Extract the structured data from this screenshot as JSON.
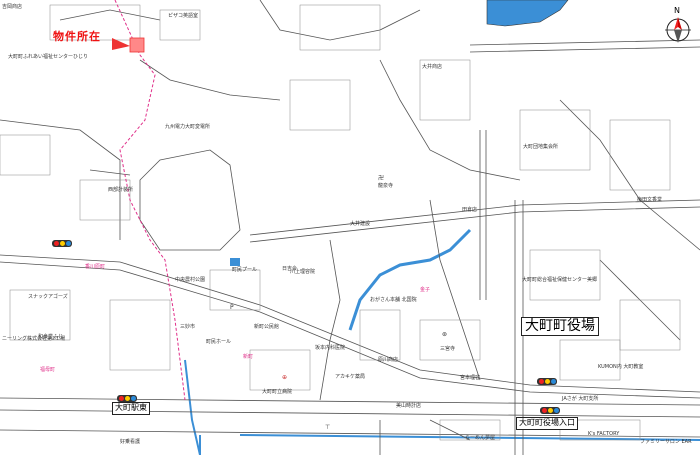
{
  "map": {
    "property_label": "物件所在",
    "town_hall_label": "大町町役場",
    "station_label": "大町駅東",
    "town_hall_entrance_label": "大町町役場入口",
    "compass_label": "N",
    "colors": {
      "river": "#3b8fd6",
      "boundary": "#e0308a",
      "property": "#e33"
    },
    "places": [
      {
        "name": "大町町ふれあい福祉センターひじり"
      },
      {
        "name": "ピザコ英語室"
      },
      {
        "name": "九州電力大町変電所"
      },
      {
        "name": "西部計装所"
      },
      {
        "name": "龍泉寺"
      },
      {
        "name": "大井商店"
      },
      {
        "name": "大町団地集会所"
      },
      {
        "name": "梅田文香堂"
      },
      {
        "name": "大井建設"
      },
      {
        "name": "田倉店"
      },
      {
        "name": "町民プール"
      },
      {
        "name": "日吉会"
      },
      {
        "name": "中央農村公園"
      },
      {
        "name": "大町町総合福祉保健センター美郷"
      },
      {
        "name": "三妙市"
      },
      {
        "name": "スナックアゴーズ"
      },
      {
        "name": "町民ホール"
      },
      {
        "name": "町民プール2"
      },
      {
        "name": "新町公民館"
      },
      {
        "name": "川上理容院"
      },
      {
        "name": "ニーリング株式会社第2工場"
      },
      {
        "name": "和食堂ふじ"
      },
      {
        "name": "大町町新型"
      },
      {
        "name": "坂本内科医院"
      },
      {
        "name": "原川商店"
      },
      {
        "name": "アカキケ薬局"
      },
      {
        "name": "大町町立病院"
      },
      {
        "name": "KUMON内 大町教室"
      },
      {
        "name": "宮本理容"
      },
      {
        "name": "JAさが 大町支所"
      },
      {
        "name": "美山時計店"
      },
      {
        "name": "らーめん夢屋"
      },
      {
        "name": "K's FACTORY"
      },
      {
        "name": "ファミリーサロン EAR"
      },
      {
        "name": "吉岡商店"
      },
      {
        "name": "おがさん本舗 北国院"
      },
      {
        "name": "三宮寺"
      },
      {
        "name": "好乗看護"
      }
    ],
    "area_labels": [
      {
        "name": "新町",
        "color": "boundary"
      },
      {
        "name": "香川原町",
        "color": "boundary"
      },
      {
        "name": "福母町",
        "color": "boundary"
      },
      {
        "name": "金子",
        "color": "boundary"
      }
    ]
  }
}
